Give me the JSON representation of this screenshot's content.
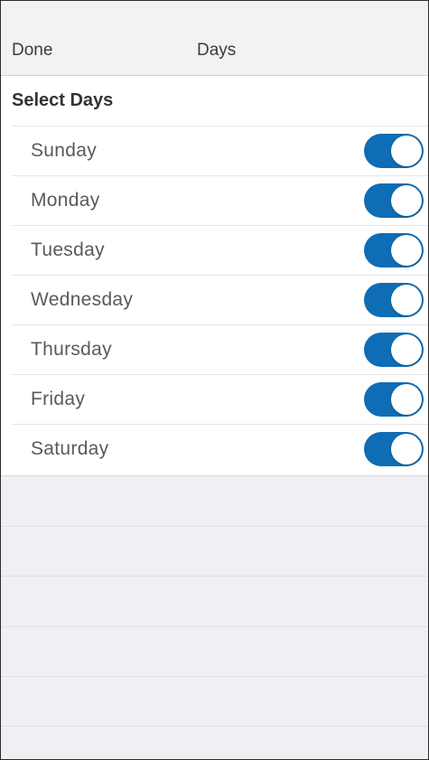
{
  "navbar": {
    "done_label": "Done",
    "title": "Days"
  },
  "section": {
    "title": "Select Days"
  },
  "days": [
    {
      "label": "Sunday",
      "enabled": true
    },
    {
      "label": "Monday",
      "enabled": true
    },
    {
      "label": "Tuesday",
      "enabled": true
    },
    {
      "label": "Wednesday",
      "enabled": true
    },
    {
      "label": "Thursday",
      "enabled": true
    },
    {
      "label": "Friday",
      "enabled": true
    },
    {
      "label": "Saturday",
      "enabled": true
    }
  ],
  "colors": {
    "toggle_on": "#0e6db4",
    "background": "#efeff4"
  }
}
